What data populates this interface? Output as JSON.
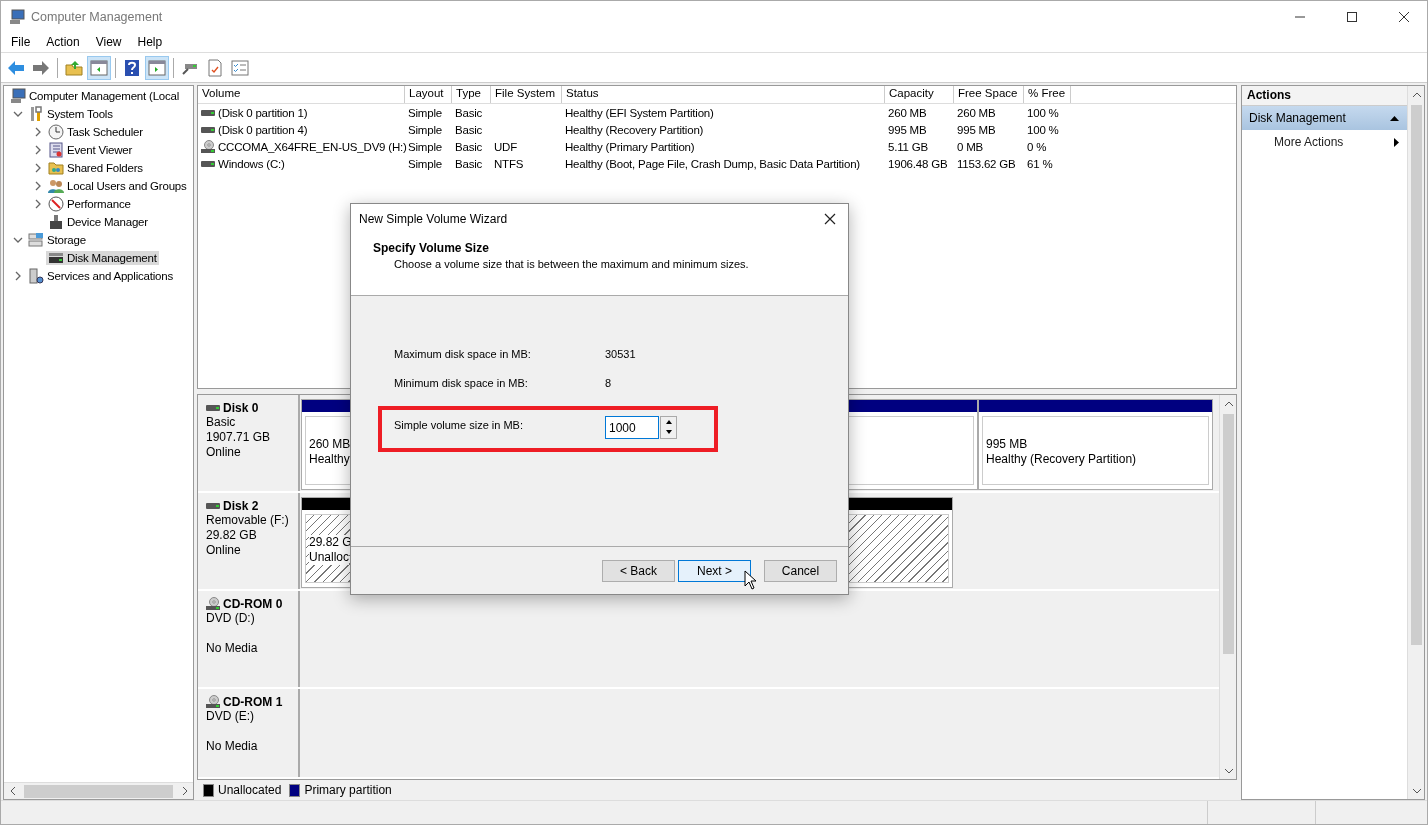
{
  "window": {
    "title": "Computer Management"
  },
  "menu": [
    "File",
    "Action",
    "View",
    "Help"
  ],
  "toolbar": [
    {
      "kind": "back",
      "pressed": false
    },
    {
      "kind": "forward",
      "pressed": false
    },
    {
      "kind": "sep"
    },
    {
      "kind": "up",
      "pressed": false
    },
    {
      "kind": "tree",
      "pressed": true
    },
    {
      "kind": "sep"
    },
    {
      "kind": "help",
      "pressed": false
    },
    {
      "kind": "pane",
      "pressed": true
    },
    {
      "kind": "sep"
    },
    {
      "kind": "connect",
      "pressed": false
    },
    {
      "kind": "check",
      "pressed": false
    },
    {
      "kind": "list",
      "pressed": false
    }
  ],
  "tree": [
    {
      "label": "Computer Management (Local",
      "kind": "computer",
      "selected": false,
      "children": [
        {
          "label": "System Tools",
          "kind": "tools",
          "selected": false,
          "expanded": true,
          "children": [
            {
              "label": "Task Scheduler",
              "kind": "clock",
              "selected": false,
              "expanded": false
            },
            {
              "label": "Event Viewer",
              "kind": "log",
              "selected": false,
              "expanded": false
            },
            {
              "label": "Shared Folders",
              "kind": "folder",
              "selected": false,
              "expanded": false
            },
            {
              "label": "Local Users and Groups",
              "kind": "users",
              "selected": false,
              "expanded": false
            },
            {
              "label": "Performance",
              "kind": "gauge",
              "selected": false,
              "expanded": false
            },
            {
              "label": "Device Manager",
              "kind": "device",
              "selected": false
            }
          ]
        },
        {
          "label": "Storage",
          "kind": "storage",
          "selected": false,
          "expanded": true,
          "children": [
            {
              "label": "Disk Management",
              "kind": "disk",
              "selected": true
            }
          ]
        },
        {
          "label": "Services and Applications",
          "kind": "services",
          "selected": false,
          "expanded": false
        }
      ]
    }
  ],
  "volumes": {
    "columns": [
      "Volume",
      "Layout",
      "Type",
      "File System",
      "Status",
      "Capacity",
      "Free Space",
      "% Free"
    ],
    "rows": [
      {
        "kind": "disk",
        "cells": [
          "(Disk 0 partition 1)",
          "Simple",
          "Basic",
          "",
          "Healthy (EFI System Partition)",
          "260 MB",
          "260 MB",
          "100 %"
        ]
      },
      {
        "kind": "disk",
        "cells": [
          "(Disk 0 partition 4)",
          "Simple",
          "Basic",
          "",
          "Healthy (Recovery Partition)",
          "995 MB",
          "995 MB",
          "100 %"
        ]
      },
      {
        "kind": "cd",
        "cells": [
          "CCCOMA_X64FRE_EN-US_DV9 (H:)",
          "Simple",
          "Basic",
          "UDF",
          "Healthy (Primary Partition)",
          "5.11 GB",
          "0 MB",
          "0 %"
        ]
      },
      {
        "kind": "disk",
        "cells": [
          "Windows (C:)",
          "Simple",
          "Basic",
          "NTFS",
          "Healthy (Boot, Page File, Crash Dump, Basic Data Partition)",
          "1906.48 GB",
          "1153.62 GB",
          "61 %"
        ]
      }
    ]
  },
  "disks": [
    {
      "kind": "disk",
      "name": "Disk 0",
      "type": "Basic",
      "size": "1907.71 GB",
      "status": "Online",
      "partitions": [
        {
          "kind": "primary",
          "size": "260 MB",
          "status": "Healthy"
        },
        {
          "kind": "primary"
        },
        {
          "kind": "primary",
          "size": "995 MB",
          "status": "Healthy (Recovery Partition)"
        }
      ]
    },
    {
      "kind": "disk",
      "name": "Disk 2",
      "type": "Removable (F:)",
      "size": "29.82 GB",
      "status": "Online",
      "partitions": [
        {
          "kind": "unallocated",
          "size": "29.82 G",
          "status": "Unalloc"
        }
      ]
    },
    {
      "kind": "cd",
      "name": "CD-ROM 0",
      "type": "DVD (D:)",
      "status": "No Media"
    },
    {
      "kind": "cd",
      "name": "CD-ROM 1",
      "type": "DVD (E:)",
      "status": "No Media"
    }
  ],
  "legend": [
    {
      "label": "Unallocated",
      "color": "#000000"
    },
    {
      "label": "Primary partition",
      "color": "#000080"
    }
  ],
  "actions": {
    "title": "Actions",
    "items": [
      {
        "label": "Disk Management",
        "kind": "section",
        "selected": true
      },
      {
        "label": "More Actions",
        "kind": "submenu",
        "selected": false
      }
    ]
  },
  "dialog": {
    "title": "New Simple Volume Wizard",
    "heading": "Specify Volume Size",
    "subheading": "Choose a volume size that is between the maximum and minimum sizes.",
    "fields": [
      {
        "label": "Maximum disk space in MB:",
        "value": "30531"
      },
      {
        "label": "Minimum disk space in MB:",
        "value": "8"
      }
    ],
    "input": {
      "label": "Simple volume size in MB:",
      "value": "1000",
      "highlighted": true
    },
    "buttons": [
      {
        "label": "< Back",
        "default": false
      },
      {
        "label": "Next >",
        "default": true
      },
      {
        "label": "Cancel",
        "default": false
      }
    ]
  }
}
